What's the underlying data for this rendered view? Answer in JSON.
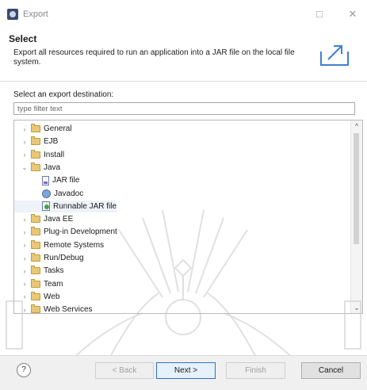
{
  "window": {
    "title": "Export",
    "maximize_glyph": "□",
    "close_glyph": "✕"
  },
  "header": {
    "title": "Select",
    "description": "Export all resources required to run an application into a JAR file on the local file system."
  },
  "destination": {
    "label": "Select an export destination:",
    "filter_placeholder": "type filter text",
    "filter_value": ""
  },
  "tree": {
    "items": [
      {
        "label": "General",
        "icon": "folder-icon",
        "expander": "›",
        "depth": 0
      },
      {
        "label": "EJB",
        "icon": "folder-icon",
        "expander": "›",
        "depth": 0
      },
      {
        "label": "Install",
        "icon": "folder-icon",
        "expander": "›",
        "depth": 0
      },
      {
        "label": "Java",
        "icon": "folder-icon",
        "expander": "⌄",
        "depth": 0
      },
      {
        "label": "JAR file",
        "icon": "jar-icon",
        "expander": "",
        "depth": 1
      },
      {
        "label": "Javadoc",
        "icon": "javadoc-icon",
        "expander": "",
        "depth": 1
      },
      {
        "label": "Runnable JAR file",
        "icon": "runnable-jar-icon",
        "expander": "",
        "depth": 1,
        "selected": true
      },
      {
        "label": "Java EE",
        "icon": "folder-icon",
        "expander": "›",
        "depth": 0
      },
      {
        "label": "Plug-in Development",
        "icon": "folder-icon",
        "expander": "›",
        "depth": 0
      },
      {
        "label": "Remote Systems",
        "icon": "folder-icon",
        "expander": "›",
        "depth": 0
      },
      {
        "label": "Run/Debug",
        "icon": "folder-icon",
        "expander": "›",
        "depth": 0
      },
      {
        "label": "Tasks",
        "icon": "folder-icon",
        "expander": "›",
        "depth": 0
      },
      {
        "label": "Team",
        "icon": "folder-icon",
        "expander": "›",
        "depth": 0
      },
      {
        "label": "Web",
        "icon": "folder-icon",
        "expander": "›",
        "depth": 0
      },
      {
        "label": "Web Services",
        "icon": "folder-icon",
        "expander": "›",
        "depth": 0
      }
    ],
    "scroll_up_glyph": "^",
    "scroll_down_glyph": "⌄"
  },
  "footer": {
    "help_glyph": "?",
    "back_label": "< Back",
    "next_label": "Next >",
    "finish_label": "Finish",
    "cancel_label": "Cancel"
  },
  "colors": {
    "primary_button_border": "#2f6fd0",
    "folder": "#e8c877",
    "selected_row": "#eef2f9"
  }
}
